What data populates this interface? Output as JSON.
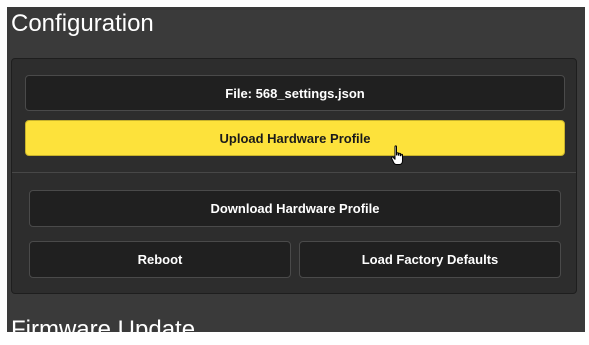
{
  "configuration": {
    "title": "Configuration",
    "file_label": "File: 568_settings.json",
    "upload_label": "Upload Hardware Profile",
    "download_label": "Download Hardware Profile",
    "reboot_label": "Reboot",
    "factory_defaults_label": "Load Factory Defaults"
  },
  "firmware": {
    "title": "Firmware Update"
  },
  "colors": {
    "panel_bg": "#3a3a3a",
    "card_bg": "#2d2d2d",
    "button_bg": "#202020",
    "accent_yellow": "#fde23b"
  },
  "icons": {
    "cursor": "hand-pointer-icon"
  }
}
